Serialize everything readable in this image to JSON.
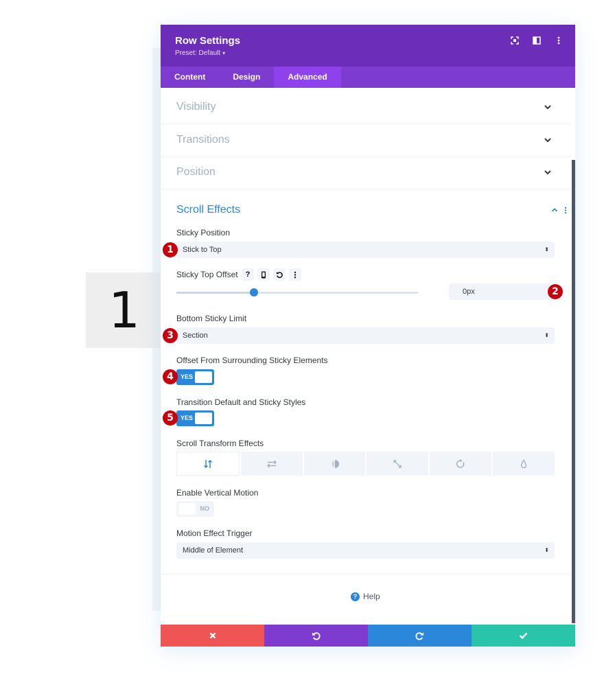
{
  "step_marker": "1",
  "modal": {
    "title": "Row Settings",
    "preset": "Preset: Default",
    "header_icons": [
      "fullscreen-icon",
      "sidebar-toggle-icon",
      "more-vertical-icon"
    ]
  },
  "tabs": [
    {
      "label": "Content",
      "active": false
    },
    {
      "label": "Design",
      "active": false
    },
    {
      "label": "Advanced",
      "active": true
    }
  ],
  "sections": {
    "visibility": "Visibility",
    "transitions": "Transitions",
    "position": "Position",
    "scroll_effects": "Scroll Effects"
  },
  "fields": {
    "sticky_position": {
      "label": "Sticky Position",
      "value": "Stick to Top"
    },
    "sticky_top_offset": {
      "label": "Sticky Top Offset",
      "value": "0px",
      "slider_level": 0.32
    },
    "bottom_sticky_limit": {
      "label": "Bottom Sticky Limit",
      "value": "Section"
    },
    "offset_surrounding": {
      "label": "Offset From Surrounding Sticky Elements",
      "toggle": "YES"
    },
    "transition_styles": {
      "label": "Transition Default and Sticky Styles",
      "toggle": "YES"
    },
    "scroll_transform": {
      "label": "Scroll Transform Effects"
    },
    "vertical_motion": {
      "label": "Enable Vertical Motion",
      "toggle": "NO"
    },
    "motion_trigger": {
      "label": "Motion Effect Trigger",
      "value": "Middle of Element"
    }
  },
  "effect_icons": [
    "vertical-motion-icon",
    "horizontal-motion-icon",
    "fading-icon",
    "scaling-icon",
    "rotating-icon",
    "blur-icon"
  ],
  "badges": [
    "1",
    "2",
    "3",
    "4",
    "5"
  ],
  "help": "Help",
  "colors": {
    "header": "#6c2eb9",
    "tabs": "#7e3bd0",
    "active_tab": "#8f42ec",
    "accent_blue": "#2b87da",
    "badge_red": "#c8000b",
    "cancel": "#ef5555",
    "undo": "#7e3bd0",
    "redo": "#2b87da",
    "save": "#29c4a9"
  }
}
